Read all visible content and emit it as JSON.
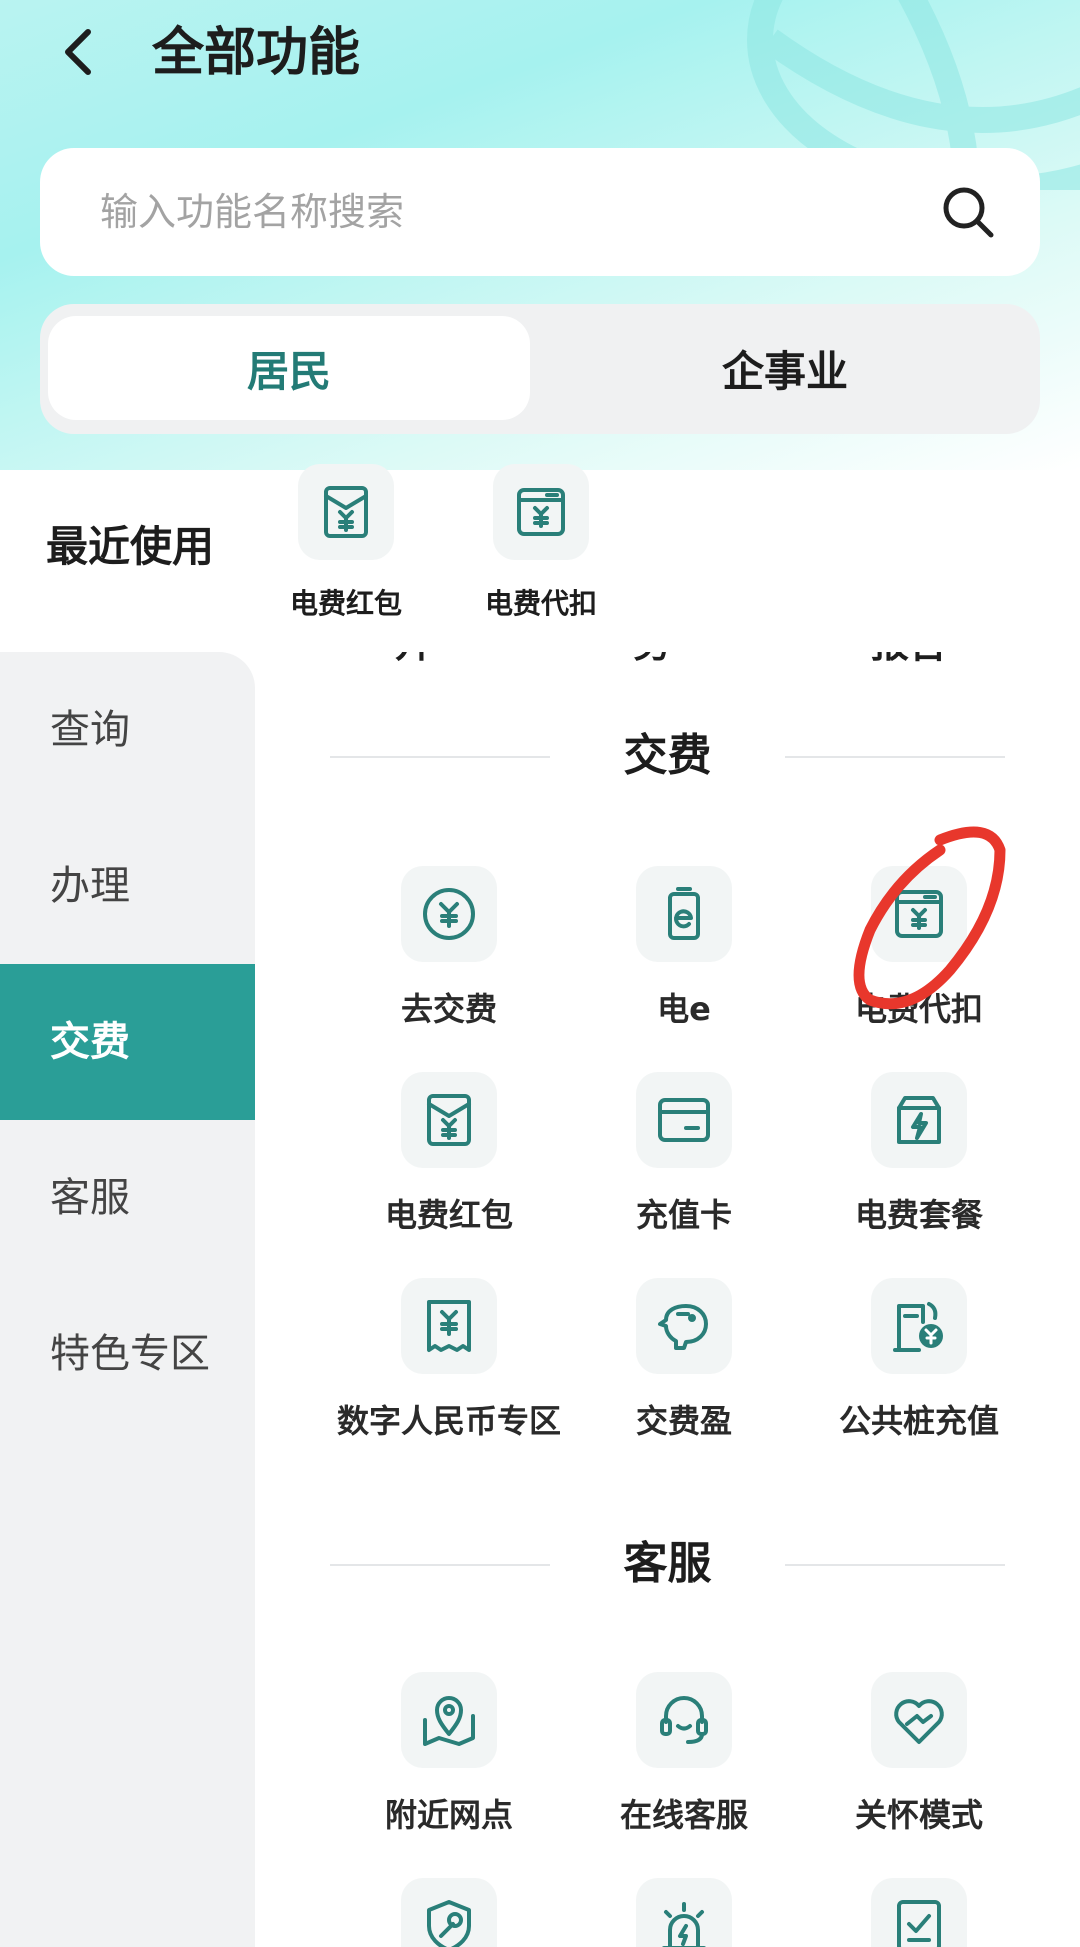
{
  "header": {
    "title": "全部功能"
  },
  "search": {
    "placeholder": "输入功能名称搜索"
  },
  "tabs": [
    {
      "label": "居民"
    },
    {
      "label": "企事业"
    }
  ],
  "recent": {
    "label": "最近使用",
    "items": [
      {
        "label": "电费红包",
        "icon": "red-packet-icon"
      },
      {
        "label": "电费代扣",
        "icon": "auto-deduct-icon"
      }
    ]
  },
  "sidebar": {
    "items": [
      {
        "label": "查询"
      },
      {
        "label": "办理"
      },
      {
        "label": "交费"
      },
      {
        "label": "客服"
      },
      {
        "label": "特色专区"
      }
    ]
  },
  "sections": [
    {
      "title": "交费",
      "items": [
        {
          "label": "去交费",
          "icon": "yuan-coin-icon"
        },
        {
          "label": "电e",
          "icon": "battery-e-icon"
        },
        {
          "label": "电费代扣",
          "icon": "auto-deduct-icon"
        },
        {
          "label": "电费红包",
          "icon": "red-packet-icon"
        },
        {
          "label": "充值卡",
          "icon": "card-icon"
        },
        {
          "label": "电费套餐",
          "icon": "package-bolt-icon"
        },
        {
          "label": "数字人民币专区",
          "icon": "receipt-yuan-icon"
        },
        {
          "label": "交费盈",
          "icon": "piggy-bank-icon"
        },
        {
          "label": "公共桩充值",
          "icon": "charging-pile-icon"
        }
      ]
    },
    {
      "title": "客服",
      "items": [
        {
          "label": "附近网点",
          "icon": "map-pin-icon"
        },
        {
          "label": "在线客服",
          "icon": "headset-icon"
        },
        {
          "label": "关怀模式",
          "icon": "heart-hands-icon"
        },
        {
          "label": "",
          "icon": "shield-wrench-icon"
        },
        {
          "label": "",
          "icon": "alarm-bolt-icon"
        },
        {
          "label": "",
          "icon": "document-check-icon"
        }
      ]
    }
  ],
  "colors": {
    "accent": "#2a9e97",
    "accent_text": "#237b76",
    "icon_stroke": "#2a7f79",
    "annotation": "#e8372c"
  }
}
